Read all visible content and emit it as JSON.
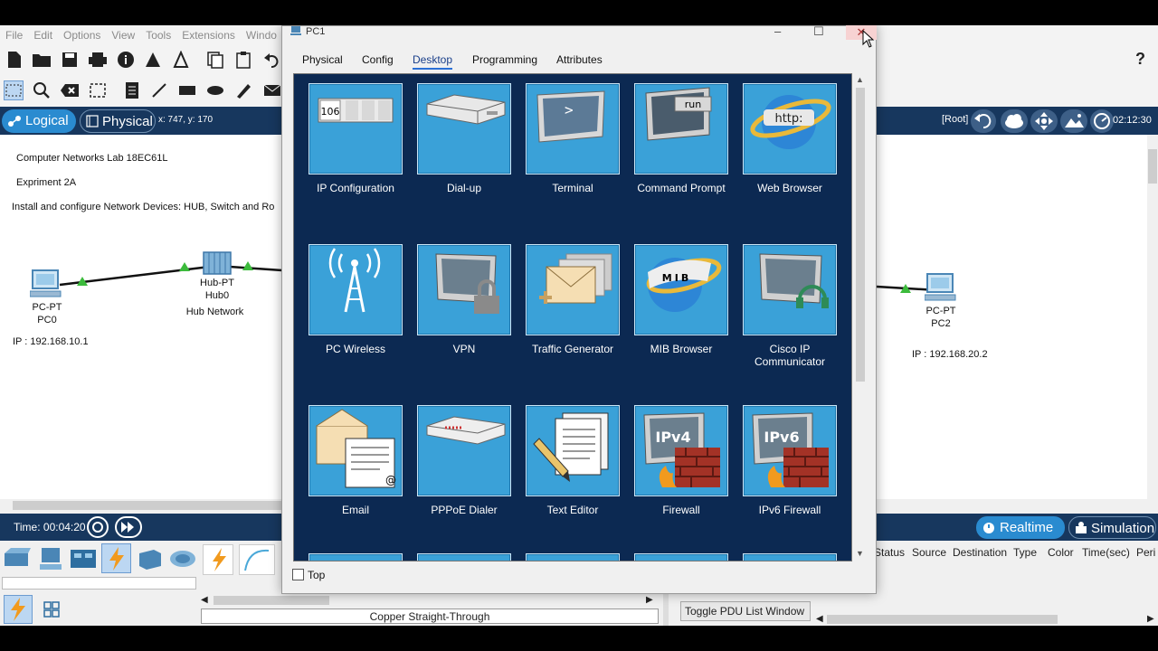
{
  "menu": [
    "File",
    "Edit",
    "Options",
    "View",
    "Tools",
    "Extensions",
    "Windo"
  ],
  "logical_tab": "Logical",
  "physical_tab": "Physical",
  "coords": "x: 747, y: 170",
  "root_label": "[Root]",
  "clock": "02:12:30",
  "canvas": {
    "notes": [
      "Computer Networks Lab 18EC61L",
      "Expriment 2A",
      "Install and configure Network Devices: HUB, Switch and Ro"
    ],
    "pc0": {
      "type": "PC-PT",
      "name": "PC0",
      "ip": "IP : 192.168.10.1"
    },
    "hub0": {
      "type": "Hub-PT",
      "name": "Hub0",
      "label": "Hub Network"
    },
    "pc2": {
      "type": "PC-PT",
      "name": "PC2",
      "ip": "IP : 192.168.20.2"
    }
  },
  "time_label": "Time: 00:04:20",
  "realtime_label": "Realtime",
  "simulation_label": "Simulation",
  "pdu_columns": [
    "Status",
    "Source",
    "Destination",
    "Type",
    "Color",
    "Time(sec)",
    "Peri"
  ],
  "connection_label": "Copper Straight-Through",
  "toggle_pdu": "Toggle PDU List Window",
  "help_icon": "?",
  "dialog": {
    "title": "PC1",
    "tabs": [
      "Physical",
      "Config",
      "Desktop",
      "Programming",
      "Attributes"
    ],
    "active_tab": "Desktop",
    "apps": [
      {
        "label": "IP Configuration",
        "icon": "ip-config-icon",
        "glyph": "106"
      },
      {
        "label": "Dial-up",
        "icon": "dialup-modem-icon"
      },
      {
        "label": "Terminal",
        "icon": "terminal-icon",
        "glyph": ">"
      },
      {
        "label": "Command Prompt",
        "icon": "command-prompt-icon",
        "glyph": "run"
      },
      {
        "label": "Web Browser",
        "icon": "web-browser-icon",
        "glyph": "http:"
      },
      {
        "label": "PC Wireless",
        "icon": "wireless-antenna-icon"
      },
      {
        "label": "VPN",
        "icon": "vpn-lock-icon"
      },
      {
        "label": "Traffic Generator",
        "icon": "traffic-generator-icon"
      },
      {
        "label": "MIB Browser",
        "icon": "mib-browser-icon",
        "glyph": "MIB"
      },
      {
        "label": "Cisco IP Communicator",
        "icon": "ip-communicator-icon"
      },
      {
        "label": "Email",
        "icon": "email-icon",
        "glyph": "@"
      },
      {
        "label": "PPPoE Dialer",
        "icon": "pppoe-dialer-icon"
      },
      {
        "label": "Text Editor",
        "icon": "text-editor-icon"
      },
      {
        "label": "Firewall",
        "icon": "firewall-icon",
        "glyph": "IPv4"
      },
      {
        "label": "IPv6 Firewall",
        "icon": "ipv6-firewall-icon",
        "glyph": "IPv6"
      }
    ],
    "top_checkbox_label": "Top"
  },
  "colors": {
    "accent_blue": "#2a8bd0",
    "navy": "#17375e",
    "tile": "#3aa1d8",
    "app_bg": "#0c2952"
  }
}
